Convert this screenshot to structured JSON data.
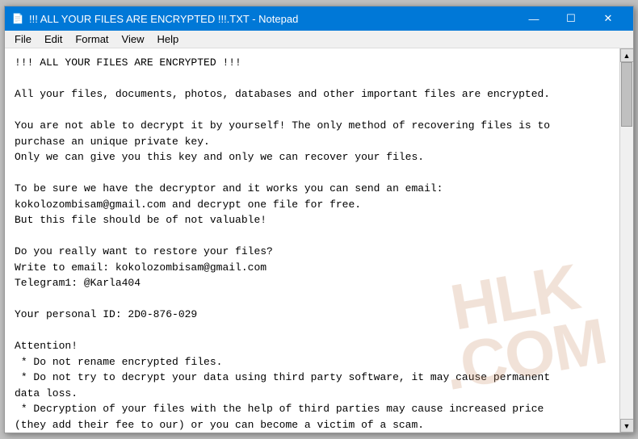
{
  "window": {
    "title": "!!! ALL YOUR FILES ARE ENCRYPTED !!!.TXT - Notepad",
    "icon": "📄"
  },
  "title_bar": {
    "minimize_label": "—",
    "maximize_label": "☐",
    "close_label": "✕"
  },
  "menu": {
    "items": [
      "File",
      "Edit",
      "Format",
      "View",
      "Help"
    ]
  },
  "content": {
    "text": "!!! ALL YOUR FILES ARE ENCRYPTED !!!\n\nAll your files, documents, photos, databases and other important files are encrypted.\n\nYou are not able to decrypt it by yourself! The only method of recovering files is to\npurchase an unique private key.\nOnly we can give you this key and only we can recover your files.\n\nTo be sure we have the decryptor and it works you can send an email:\nkokolozombisam@gmail.com and decrypt one file for free.\nBut this file should be of not valuable!\n\nDo you really want to restore your files?\nWrite to email: kokolozombisam@gmail.com\nTelegram1: @Karla404\n\nYour personal ID: 2D0-876-029\n\nAttention!\n * Do not rename encrypted files.\n * Do not try to decrypt your data using third party software, it may cause permanent\ndata loss.\n * Decryption of your files with the help of third parties may cause increased price\n(they add their fee to our) or you can become a victim of a scam."
  },
  "watermark": {
    "line1": "HLK",
    "line2": ".COM"
  }
}
